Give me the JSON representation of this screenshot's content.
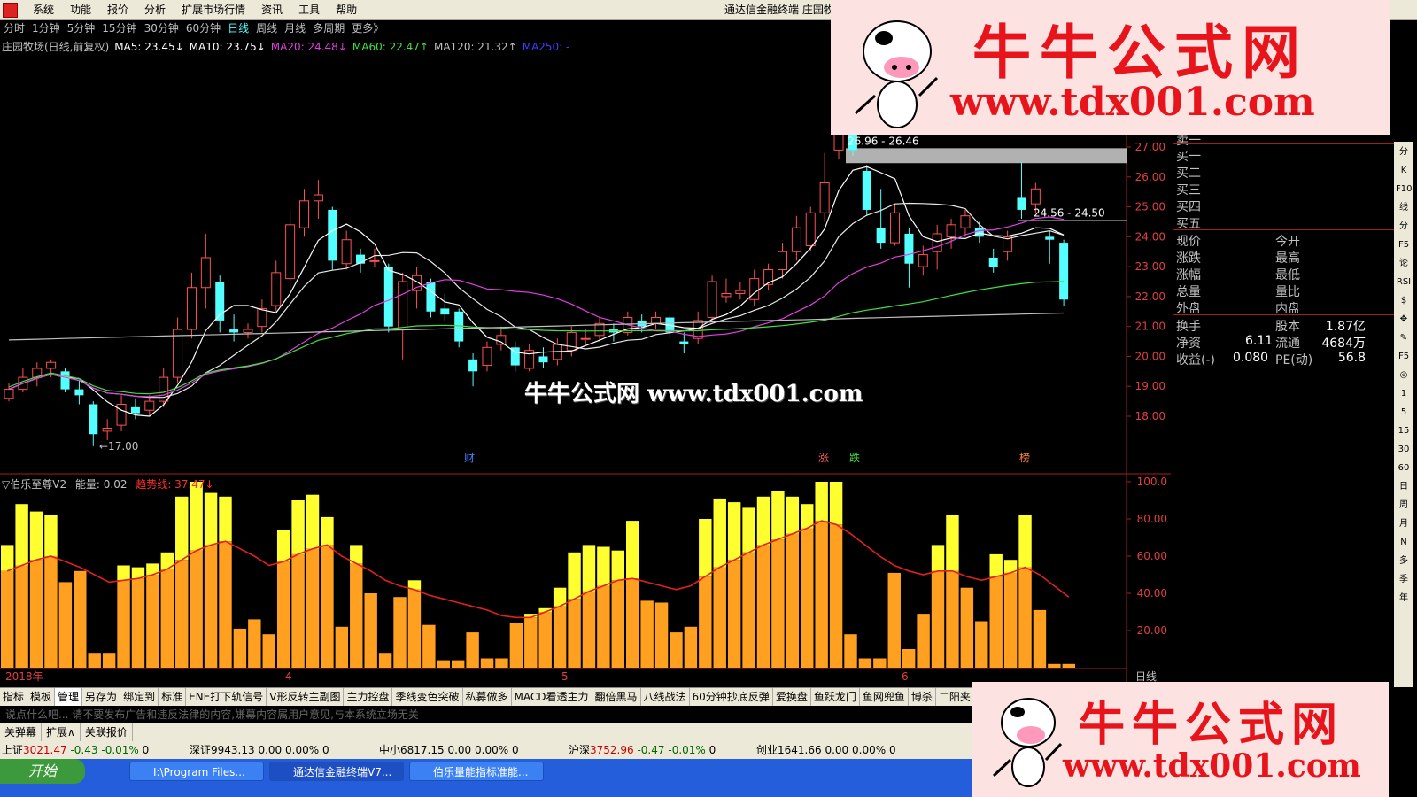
{
  "menubar": {
    "items": [
      "系统",
      "功能",
      "报价",
      "分析",
      "扩展市场行情",
      "资讯",
      "工具",
      "帮助"
    ],
    "title": "通达信金融终端  庄园牧场"
  },
  "periods": {
    "items": [
      "分时",
      "1分钟",
      "5分钟",
      "15分钟",
      "30分钟",
      "60分钟",
      "日线",
      "周线",
      "月线",
      "多周期",
      "更多》"
    ],
    "active": "日线"
  },
  "main": {
    "stock": "庄园牧场(日线,前复权)",
    "ma": [
      {
        "label": "MA5: 23.45↓",
        "color": "#ffffff"
      },
      {
        "label": "MA10: 23.75↓",
        "color": "#ffffff"
      },
      {
        "label": "MA20: 24.48↓",
        "color": "#e040e0"
      },
      {
        "label": "MA60: 22.47↑",
        "color": "#40e040"
      },
      {
        "label": "MA120: 21.32↑",
        "color": "#c0c0c0"
      },
      {
        "label": "MA250: -",
        "color": "#4040ff"
      }
    ],
    "y_ticks": [
      "27.00",
      "26.00",
      "25.00",
      "24.00",
      "23.00",
      "22.00",
      "21.00",
      "20.00",
      "19.00",
      "18.00"
    ],
    "annotations": {
      "low": "←17.00",
      "gap1": "26.96 - 26.46",
      "gap2": "24.56 - 24.50"
    },
    "events": [
      {
        "label": "财",
        "color": "#4080ff"
      },
      {
        "label": "涨",
        "color": "#ff6060"
      },
      {
        "label": "跌",
        "color": "#40e040"
      },
      {
        "label": "榜",
        "color": "#ff8040"
      }
    ]
  },
  "indicator": {
    "name": "▽伯乐至尊V2",
    "energy": "能量: 0.02",
    "trend": "趋势线: 37.47↓",
    "y_ticks": [
      "100.0",
      "80.00",
      "60.00",
      "40.00",
      "20.00"
    ],
    "x_labels": [
      "2018年",
      "4",
      "5",
      "6"
    ],
    "period_label": "日线"
  },
  "quote": {
    "sell_partial": "卖一",
    "buy": [
      "买一",
      "买二",
      "买三",
      "买四",
      "买五"
    ],
    "left_col": [
      "现价",
      "涨跌",
      "涨幅",
      "总量",
      "外盘"
    ],
    "right_col": [
      "今开",
      "最高",
      "最低",
      "量比",
      "内盘"
    ],
    "extra": [
      {
        "l": "换手",
        "m": "股本",
        "v": "1.87亿"
      },
      {
        "l": "净资",
        "m": "6.11",
        "m2": "流通",
        "v": "4684万"
      },
      {
        "l": "收益(-)",
        "m": "0.080",
        "m2": "PE(动)",
        "v": "56.8"
      }
    ]
  },
  "toolstrip": [
    "分",
    "K",
    "F10",
    "线",
    "分",
    "F5",
    "论",
    "RSI",
    "$",
    "✥",
    "✎",
    "F5",
    "◎",
    "1",
    "5",
    "15",
    "30",
    "60",
    "日",
    "周",
    "月",
    "N",
    "多",
    "季",
    "年"
  ],
  "tabs": [
    "指标",
    "模板",
    "管理",
    "另存为",
    "绑定到",
    "标准",
    "ENE打下轨信号",
    "V形反转主副图",
    "主力控盘",
    "季线变色突破",
    "私募做多",
    "MACD看透主力",
    "翻倍黑马",
    "八线战法",
    "60分钟抄底反弹",
    "爱换盘",
    "鱼跃龙门",
    "鱼网兜鱼",
    "博杀",
    "二阳夹二"
  ],
  "tabs_active": "管理",
  "ticker_placeholder": "说点什么吧...  请不要发布广告和违反法律的内容,嫌幕内容属用户意见,与本系统立场无关",
  "subtabs": [
    "关弹幕",
    "扩展∧",
    "关联报价"
  ],
  "indices": [
    {
      "name": "上证",
      "value": "3021.47",
      "chg": "-0.43",
      "pct": "-0.01%",
      "vol": "0"
    },
    {
      "name": "深证",
      "value": "9943.13",
      "chg": "0.00",
      "pct": "0.00%",
      "vol": "0"
    },
    {
      "name": "中小",
      "value": "6817.15",
      "chg": "0.00",
      "pct": "0.00%",
      "vol": "0"
    },
    {
      "name": "沪深",
      "value": "3752.96",
      "chg": "-0.47",
      "pct": "-0.01%",
      "vol": "0"
    },
    {
      "name": "创业",
      "value": "1641.66",
      "chg": "0.00",
      "pct": "0.00%",
      "vol": "0"
    }
  ],
  "taskbar": {
    "start": "开始",
    "tasks": [
      "I:\\Program Files...",
      "通达信金融终端V7...",
      "伯乐量能指标准能..."
    ]
  },
  "watermark": {
    "title": "牛牛公式网",
    "url": "www.tdx001.com",
    "center": "牛牛公式网 www.tdx001.com"
  },
  "chart_data": [
    {
      "type": "candlestick",
      "series_order": "chronological",
      "candles": [
        {
          "o": 18.6,
          "c": 18.9,
          "h": 19.1,
          "l": 18.5
        },
        {
          "o": 18.9,
          "c": 19.3,
          "h": 19.6,
          "l": 18.8
        },
        {
          "o": 19.3,
          "c": 19.6,
          "h": 19.8,
          "l": 19.0
        },
        {
          "o": 19.6,
          "c": 19.8,
          "h": 19.9,
          "l": 19.3
        },
        {
          "o": 19.5,
          "c": 18.9,
          "h": 19.6,
          "l": 18.8
        },
        {
          "o": 18.9,
          "c": 18.7,
          "h": 19.2,
          "l": 18.4
        },
        {
          "o": 18.4,
          "c": 17.4,
          "h": 18.5,
          "l": 17.0
        },
        {
          "o": 17.5,
          "c": 17.6,
          "h": 17.9,
          "l": 17.2
        },
        {
          "o": 17.7,
          "c": 18.4,
          "h": 18.7,
          "l": 17.5
        },
        {
          "o": 18.3,
          "c": 18.1,
          "h": 18.6,
          "l": 17.9
        },
        {
          "o": 18.2,
          "c": 18.5,
          "h": 18.7,
          "l": 18.0
        },
        {
          "o": 18.5,
          "c": 19.3,
          "h": 19.6,
          "l": 18.3
        },
        {
          "o": 19.3,
          "c": 20.9,
          "h": 21.3,
          "l": 19.1
        },
        {
          "o": 20.9,
          "c": 22.3,
          "h": 22.8,
          "l": 20.6
        },
        {
          "o": 22.3,
          "c": 23.3,
          "h": 24.1,
          "l": 21.6
        },
        {
          "o": 22.5,
          "c": 21.2,
          "h": 22.7,
          "l": 20.8
        },
        {
          "o": 20.9,
          "c": 20.8,
          "h": 21.4,
          "l": 20.5
        },
        {
          "o": 20.8,
          "c": 20.9,
          "h": 21.1,
          "l": 20.6
        },
        {
          "o": 21.0,
          "c": 21.6,
          "h": 21.9,
          "l": 20.8
        },
        {
          "o": 21.7,
          "c": 22.8,
          "h": 23.2,
          "l": 21.5
        },
        {
          "o": 22.6,
          "c": 24.4,
          "h": 24.9,
          "l": 22.3
        },
        {
          "o": 24.3,
          "c": 25.2,
          "h": 25.6,
          "l": 24.0
        },
        {
          "o": 25.2,
          "c": 25.4,
          "h": 25.9,
          "l": 24.6
        },
        {
          "o": 24.9,
          "c": 23.2,
          "h": 25.0,
          "l": 22.9
        },
        {
          "o": 23.1,
          "c": 23.9,
          "h": 24.2,
          "l": 22.9
        },
        {
          "o": 23.4,
          "c": 23.1,
          "h": 23.6,
          "l": 22.8
        },
        {
          "o": 23.2,
          "c": 23.2,
          "h": 23.6,
          "l": 23.0
        },
        {
          "o": 23.0,
          "c": 21.0,
          "h": 23.1,
          "l": 20.8
        },
        {
          "o": 20.9,
          "c": 22.5,
          "h": 22.8,
          "l": 19.9
        },
        {
          "o": 22.2,
          "c": 22.7,
          "h": 23.0,
          "l": 21.6
        },
        {
          "o": 22.5,
          "c": 21.5,
          "h": 22.6,
          "l": 21.3
        },
        {
          "o": 21.6,
          "c": 21.4,
          "h": 22.1,
          "l": 21.2
        },
        {
          "o": 21.5,
          "c": 20.5,
          "h": 21.6,
          "l": 20.3
        },
        {
          "o": 19.9,
          "c": 19.5,
          "h": 20.1,
          "l": 19.0
        },
        {
          "o": 19.7,
          "c": 20.3,
          "h": 20.5,
          "l": 19.5
        },
        {
          "o": 20.4,
          "c": 20.7,
          "h": 21.0,
          "l": 20.2
        },
        {
          "o": 20.3,
          "c": 19.7,
          "h": 20.5,
          "l": 19.5
        },
        {
          "o": 19.6,
          "c": 20.2,
          "h": 20.4,
          "l": 19.5
        },
        {
          "o": 20.0,
          "c": 19.8,
          "h": 20.3,
          "l": 19.6
        },
        {
          "o": 19.9,
          "c": 20.4,
          "h": 20.6,
          "l": 19.7
        },
        {
          "o": 20.2,
          "c": 20.8,
          "h": 21.0,
          "l": 20.0
        },
        {
          "o": 20.6,
          "c": 20.6,
          "h": 20.9,
          "l": 20.4
        },
        {
          "o": 20.7,
          "c": 21.1,
          "h": 21.3,
          "l": 20.5
        },
        {
          "o": 20.9,
          "c": 20.8,
          "h": 21.1,
          "l": 20.5
        },
        {
          "o": 20.8,
          "c": 21.3,
          "h": 21.5,
          "l": 20.7
        },
        {
          "o": 21.2,
          "c": 21.0,
          "h": 21.4,
          "l": 20.8
        },
        {
          "o": 21.1,
          "c": 21.3,
          "h": 21.5,
          "l": 20.9
        },
        {
          "o": 21.3,
          "c": 20.8,
          "h": 21.4,
          "l": 20.6
        },
        {
          "o": 20.5,
          "c": 20.4,
          "h": 20.8,
          "l": 20.1
        },
        {
          "o": 20.6,
          "c": 21.2,
          "h": 21.5,
          "l": 20.4
        },
        {
          "o": 21.3,
          "c": 22.5,
          "h": 22.7,
          "l": 21.2
        },
        {
          "o": 22.0,
          "c": 22.1,
          "h": 22.6,
          "l": 21.8
        },
        {
          "o": 22.1,
          "c": 22.2,
          "h": 22.5,
          "l": 21.9
        },
        {
          "o": 21.9,
          "c": 22.6,
          "h": 22.9,
          "l": 21.7
        },
        {
          "o": 22.4,
          "c": 22.9,
          "h": 23.1,
          "l": 22.2
        },
        {
          "o": 22.9,
          "c": 23.5,
          "h": 23.8,
          "l": 22.6
        },
        {
          "o": 23.5,
          "c": 24.3,
          "h": 24.7,
          "l": 23.2
        },
        {
          "o": 23.7,
          "c": 24.8,
          "h": 25.0,
          "l": 23.5
        },
        {
          "o": 24.8,
          "c": 25.8,
          "h": 26.8,
          "l": 24.5
        },
        {
          "o": 26.9,
          "c": 29.3,
          "h": 29.5,
          "l": 26.6
        },
        {
          "o": 29.6,
          "c": 26.9,
          "h": 29.9,
          "l": 26.7
        },
        {
          "o": 26.2,
          "c": 24.9,
          "h": 26.4,
          "l": 24.7
        },
        {
          "o": 24.3,
          "c": 23.8,
          "h": 25.6,
          "l": 23.6
        },
        {
          "o": 23.8,
          "c": 24.8,
          "h": 25.1,
          "l": 23.7
        },
        {
          "o": 24.1,
          "c": 23.1,
          "h": 24.3,
          "l": 22.3
        },
        {
          "o": 23.0,
          "c": 23.4,
          "h": 23.7,
          "l": 22.7
        },
        {
          "o": 23.5,
          "c": 24.1,
          "h": 24.4,
          "l": 22.9
        },
        {
          "o": 24.0,
          "c": 24.4,
          "h": 24.6,
          "l": 23.6
        },
        {
          "o": 24.3,
          "c": 24.7,
          "h": 24.9,
          "l": 24.0
        },
        {
          "o": 24.3,
          "c": 24.0,
          "h": 24.5,
          "l": 23.8
        },
        {
          "o": 23.3,
          "c": 23.0,
          "h": 23.6,
          "l": 22.8
        },
        {
          "o": 23.5,
          "c": 24.0,
          "h": 24.2,
          "l": 23.2
        },
        {
          "o": 25.3,
          "c": 24.9,
          "h": 26.5,
          "l": 24.6
        },
        {
          "o": 25.1,
          "c": 25.6,
          "h": 25.8,
          "l": 24.8
        },
        {
          "o": 24.0,
          "c": 23.9,
          "h": 24.2,
          "l": 23.1
        },
        {
          "o": 23.8,
          "c": 21.9,
          "h": 23.9,
          "l": 21.7
        }
      ],
      "ylim": [
        17.5,
        27.5
      ]
    },
    {
      "type": "bar",
      "name": "伯乐至尊V2",
      "values": [
        66,
        88,
        84,
        82,
        46,
        52,
        8,
        8,
        55,
        54,
        56,
        62,
        92,
        100,
        94,
        92,
        21,
        26,
        18,
        74,
        90,
        93,
        81,
        22,
        66,
        40,
        8,
        38,
        47,
        23,
        4,
        4,
        19,
        5,
        5,
        24,
        29,
        32,
        43,
        62,
        66,
        65,
        63,
        79,
        36,
        35,
        19,
        22,
        80,
        91,
        89,
        86,
        92,
        95,
        92,
        88,
        100,
        100,
        18,
        5,
        5,
        51,
        10,
        29,
        66,
        82,
        43,
        25,
        61,
        58,
        82,
        31,
        2,
        2
      ],
      "trend": [
        52,
        55,
        58,
        60,
        57,
        54,
        50,
        46,
        47,
        48,
        50,
        53,
        58,
        63,
        66,
        68,
        64,
        60,
        55,
        57,
        61,
        64,
        66,
        60,
        56,
        52,
        47,
        44,
        42,
        39,
        37,
        35,
        33,
        31,
        28,
        27,
        27,
        30,
        33,
        37,
        41,
        44,
        47,
        48,
        46,
        44,
        42,
        44,
        49,
        54,
        58,
        62,
        66,
        69,
        72,
        75,
        79,
        77,
        72,
        66,
        60,
        55,
        52,
        50,
        52,
        52,
        49,
        47,
        49,
        51,
        54,
        50,
        44,
        38
      ],
      "ylim": [
        0,
        105
      ]
    }
  ]
}
